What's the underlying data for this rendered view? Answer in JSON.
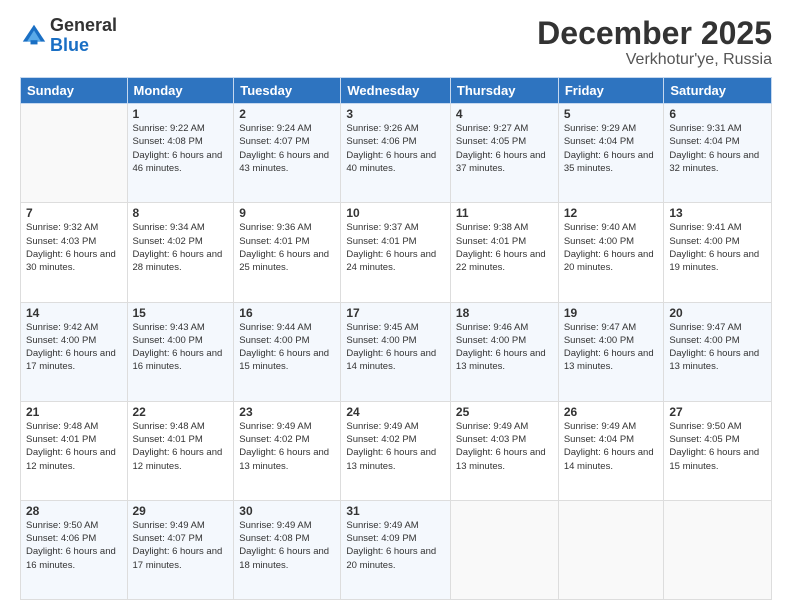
{
  "logo": {
    "general": "General",
    "blue": "Blue"
  },
  "title": "December 2025",
  "location": "Verkhotur'ye, Russia",
  "header_days": [
    "Sunday",
    "Monday",
    "Tuesday",
    "Wednesday",
    "Thursday",
    "Friday",
    "Saturday"
  ],
  "weeks": [
    [
      {
        "day": "",
        "sunrise": "",
        "sunset": "",
        "daylight": ""
      },
      {
        "day": "1",
        "sunrise": "Sunrise: 9:22 AM",
        "sunset": "Sunset: 4:08 PM",
        "daylight": "Daylight: 6 hours and 46 minutes."
      },
      {
        "day": "2",
        "sunrise": "Sunrise: 9:24 AM",
        "sunset": "Sunset: 4:07 PM",
        "daylight": "Daylight: 6 hours and 43 minutes."
      },
      {
        "day": "3",
        "sunrise": "Sunrise: 9:26 AM",
        "sunset": "Sunset: 4:06 PM",
        "daylight": "Daylight: 6 hours and 40 minutes."
      },
      {
        "day": "4",
        "sunrise": "Sunrise: 9:27 AM",
        "sunset": "Sunset: 4:05 PM",
        "daylight": "Daylight: 6 hours and 37 minutes."
      },
      {
        "day": "5",
        "sunrise": "Sunrise: 9:29 AM",
        "sunset": "Sunset: 4:04 PM",
        "daylight": "Daylight: 6 hours and 35 minutes."
      },
      {
        "day": "6",
        "sunrise": "Sunrise: 9:31 AM",
        "sunset": "Sunset: 4:04 PM",
        "daylight": "Daylight: 6 hours and 32 minutes."
      }
    ],
    [
      {
        "day": "7",
        "sunrise": "Sunrise: 9:32 AM",
        "sunset": "Sunset: 4:03 PM",
        "daylight": "Daylight: 6 hours and 30 minutes."
      },
      {
        "day": "8",
        "sunrise": "Sunrise: 9:34 AM",
        "sunset": "Sunset: 4:02 PM",
        "daylight": "Daylight: 6 hours and 28 minutes."
      },
      {
        "day": "9",
        "sunrise": "Sunrise: 9:36 AM",
        "sunset": "Sunset: 4:01 PM",
        "daylight": "Daylight: 6 hours and 25 minutes."
      },
      {
        "day": "10",
        "sunrise": "Sunrise: 9:37 AM",
        "sunset": "Sunset: 4:01 PM",
        "daylight": "Daylight: 6 hours and 24 minutes."
      },
      {
        "day": "11",
        "sunrise": "Sunrise: 9:38 AM",
        "sunset": "Sunset: 4:01 PM",
        "daylight": "Daylight: 6 hours and 22 minutes."
      },
      {
        "day": "12",
        "sunrise": "Sunrise: 9:40 AM",
        "sunset": "Sunset: 4:00 PM",
        "daylight": "Daylight: 6 hours and 20 minutes."
      },
      {
        "day": "13",
        "sunrise": "Sunrise: 9:41 AM",
        "sunset": "Sunset: 4:00 PM",
        "daylight": "Daylight: 6 hours and 19 minutes."
      }
    ],
    [
      {
        "day": "14",
        "sunrise": "Sunrise: 9:42 AM",
        "sunset": "Sunset: 4:00 PM",
        "daylight": "Daylight: 6 hours and 17 minutes."
      },
      {
        "day": "15",
        "sunrise": "Sunrise: 9:43 AM",
        "sunset": "Sunset: 4:00 PM",
        "daylight": "Daylight: 6 hours and 16 minutes."
      },
      {
        "day": "16",
        "sunrise": "Sunrise: 9:44 AM",
        "sunset": "Sunset: 4:00 PM",
        "daylight": "Daylight: 6 hours and 15 minutes."
      },
      {
        "day": "17",
        "sunrise": "Sunrise: 9:45 AM",
        "sunset": "Sunset: 4:00 PM",
        "daylight": "Daylight: 6 hours and 14 minutes."
      },
      {
        "day": "18",
        "sunrise": "Sunrise: 9:46 AM",
        "sunset": "Sunset: 4:00 PM",
        "daylight": "Daylight: 6 hours and 13 minutes."
      },
      {
        "day": "19",
        "sunrise": "Sunrise: 9:47 AM",
        "sunset": "Sunset: 4:00 PM",
        "daylight": "Daylight: 6 hours and 13 minutes."
      },
      {
        "day": "20",
        "sunrise": "Sunrise: 9:47 AM",
        "sunset": "Sunset: 4:00 PM",
        "daylight": "Daylight: 6 hours and 13 minutes."
      }
    ],
    [
      {
        "day": "21",
        "sunrise": "Sunrise: 9:48 AM",
        "sunset": "Sunset: 4:01 PM",
        "daylight": "Daylight: 6 hours and 12 minutes."
      },
      {
        "day": "22",
        "sunrise": "Sunrise: 9:48 AM",
        "sunset": "Sunset: 4:01 PM",
        "daylight": "Daylight: 6 hours and 12 minutes."
      },
      {
        "day": "23",
        "sunrise": "Sunrise: 9:49 AM",
        "sunset": "Sunset: 4:02 PM",
        "daylight": "Daylight: 6 hours and 13 minutes."
      },
      {
        "day": "24",
        "sunrise": "Sunrise: 9:49 AM",
        "sunset": "Sunset: 4:02 PM",
        "daylight": "Daylight: 6 hours and 13 minutes."
      },
      {
        "day": "25",
        "sunrise": "Sunrise: 9:49 AM",
        "sunset": "Sunset: 4:03 PM",
        "daylight": "Daylight: 6 hours and 13 minutes."
      },
      {
        "day": "26",
        "sunrise": "Sunrise: 9:49 AM",
        "sunset": "Sunset: 4:04 PM",
        "daylight": "Daylight: 6 hours and 14 minutes."
      },
      {
        "day": "27",
        "sunrise": "Sunrise: 9:50 AM",
        "sunset": "Sunset: 4:05 PM",
        "daylight": "Daylight: 6 hours and 15 minutes."
      }
    ],
    [
      {
        "day": "28",
        "sunrise": "Sunrise: 9:50 AM",
        "sunset": "Sunset: 4:06 PM",
        "daylight": "Daylight: 6 hours and 16 minutes."
      },
      {
        "day": "29",
        "sunrise": "Sunrise: 9:49 AM",
        "sunset": "Sunset: 4:07 PM",
        "daylight": "Daylight: 6 hours and 17 minutes."
      },
      {
        "day": "30",
        "sunrise": "Sunrise: 9:49 AM",
        "sunset": "Sunset: 4:08 PM",
        "daylight": "Daylight: 6 hours and 18 minutes."
      },
      {
        "day": "31",
        "sunrise": "Sunrise: 9:49 AM",
        "sunset": "Sunset: 4:09 PM",
        "daylight": "Daylight: 6 hours and 20 minutes."
      },
      {
        "day": "",
        "sunrise": "",
        "sunset": "",
        "daylight": ""
      },
      {
        "day": "",
        "sunrise": "",
        "sunset": "",
        "daylight": ""
      },
      {
        "day": "",
        "sunrise": "",
        "sunset": "",
        "daylight": ""
      }
    ]
  ]
}
